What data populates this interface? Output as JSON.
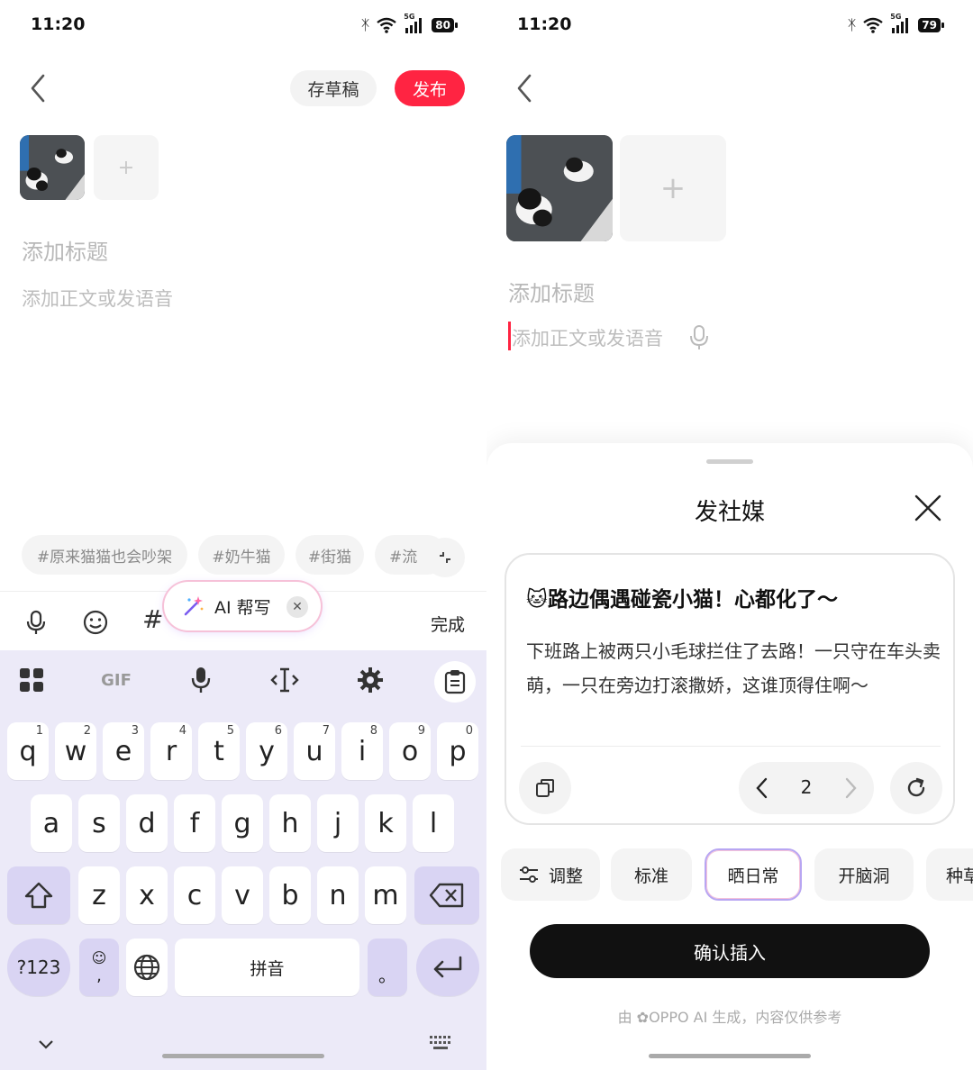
{
  "left": {
    "status": {
      "time": "11:20",
      "network": "5G",
      "battery": "80"
    },
    "header": {
      "draft_label": "存草稿",
      "publish_label": "发布"
    },
    "editor": {
      "title_placeholder": "添加标题",
      "body_placeholder": "添加正文或发语音"
    },
    "tags": [
      "#原来猫猫也会吵架",
      "#奶牛猫",
      "#街猫",
      "#流"
    ],
    "toolbar": {
      "done_label": "完成",
      "hash": "#"
    },
    "ai_pill": {
      "label": "AI 帮写"
    },
    "keyboard": {
      "gif_label": "GIF",
      "row1": [
        {
          "k": "q",
          "s": "1"
        },
        {
          "k": "w",
          "s": "2"
        },
        {
          "k": "e",
          "s": "3"
        },
        {
          "k": "r",
          "s": "4"
        },
        {
          "k": "t",
          "s": "5"
        },
        {
          "k": "y",
          "s": "6"
        },
        {
          "k": "u",
          "s": "7"
        },
        {
          "k": "i",
          "s": "8"
        },
        {
          "k": "o",
          "s": "9"
        },
        {
          "k": "p",
          "s": "0"
        }
      ],
      "row2": [
        "a",
        "s",
        "d",
        "f",
        "g",
        "h",
        "j",
        "k",
        "l"
      ],
      "row3": [
        "z",
        "x",
        "c",
        "v",
        "b",
        "n",
        "m"
      ],
      "symbols_label": "?123",
      "comma_label": ",",
      "space_label": "拼音",
      "period_label": "。"
    }
  },
  "right": {
    "status": {
      "time": "11:20",
      "network": "5G",
      "battery": "79"
    },
    "editor": {
      "title_placeholder": "添加标题",
      "body_placeholder": "添加正文或发语音"
    },
    "sheet": {
      "title": "发社媒",
      "card_title": "🐱路边偶遇碰瓷小猫！心都化了～",
      "card_body": "下班路上被两只小毛球拦住了去路！一只守在车头卖萌，一只在旁边打滚撒娇，这谁顶得住啊～",
      "page": "2",
      "styles": [
        "调整",
        "标准",
        "晒日常",
        "开脑洞",
        "种草"
      ],
      "confirm_label": "确认插入",
      "disclaimer": "由 ✿OPPO AI 生成，内容仅供参考"
    }
  },
  "colors": {
    "accent": "#ff2442",
    "keyboard_bg": "#eceaf8",
    "key_mod": "#d9d4f3"
  }
}
